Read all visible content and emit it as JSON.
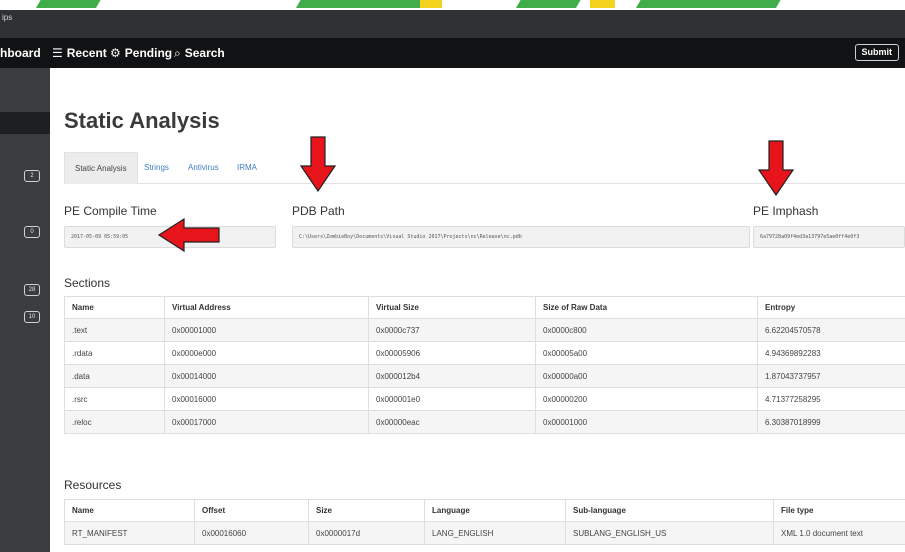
{
  "titlebar": {
    "text": "ips"
  },
  "nav": {
    "dashboard": "hboard",
    "recent": "Recent",
    "pending": "Pending",
    "search": "Search",
    "submit": "Submit",
    "icons": {
      "recent": "list-icon",
      "pending": "cogs-icon",
      "search": "search-icon"
    }
  },
  "sidebar": {
    "badges": [
      "2",
      "0",
      "28",
      "10"
    ]
  },
  "page": {
    "title": "Static Analysis"
  },
  "tabs": [
    {
      "label": "Static Analysis",
      "active": true
    },
    {
      "label": "Strings",
      "active": false
    },
    {
      "label": "Antivirus",
      "active": false
    },
    {
      "label": "IRMA",
      "active": false
    }
  ],
  "fields": {
    "compile_time": {
      "label": "PE Compile Time",
      "value": "2017-05-09 05:59:05"
    },
    "pdb_path": {
      "label": "PDB Path",
      "value": "C:\\Users\\ZombieBoy\\Documents\\Visual Studio 2017\\Projects\\nc\\Release\\nc.pdb"
    },
    "imphash": {
      "label": "PE Imphash",
      "value": "6a79728a09f4ed3a13797e5ae0ff4e0f3"
    }
  },
  "sections": {
    "title": "Sections",
    "columns": [
      "Name",
      "Virtual Address",
      "Virtual Size",
      "Size of Raw Data",
      "Entropy"
    ],
    "rows": [
      [
        ".text",
        "0x00001000",
        "0x0000c737",
        "0x0000c800",
        "6.62204570578"
      ],
      [
        ".rdata",
        "0x0000e000",
        "0x00005906",
        "0x00005a00",
        "4.94369892283"
      ],
      [
        ".data",
        "0x00014000",
        "0x000012b4",
        "0x00000a00",
        "1.87043737957"
      ],
      [
        ".rsrc",
        "0x00016000",
        "0x000001e0",
        "0x00000200",
        "4.71377258295"
      ],
      [
        ".reloc",
        "0x00017000",
        "0x00000eac",
        "0x00001000",
        "6.30387018999"
      ]
    ]
  },
  "resources": {
    "title": "Resources",
    "columns": [
      "Name",
      "Offset",
      "Size",
      "Language",
      "Sub-language",
      "File type"
    ],
    "rows": [
      [
        "RT_MANIFEST",
        "0x00016060",
        "0x0000017d",
        "LANG_ENGLISH",
        "SUBLANG_ENGLISH_US",
        "XML 1.0 document text"
      ]
    ]
  },
  "colors": {
    "navbar": "#111213",
    "sidebar": "#3a3c3f",
    "link": "#3f7fc4",
    "annotation_arrow": "#e8141b",
    "watermark_green": "#3fae4a",
    "watermark_yellow": "#f4d31e"
  },
  "annotations": [
    "arrow-pdb-path",
    "arrow-imphash",
    "arrow-compile-time"
  ]
}
